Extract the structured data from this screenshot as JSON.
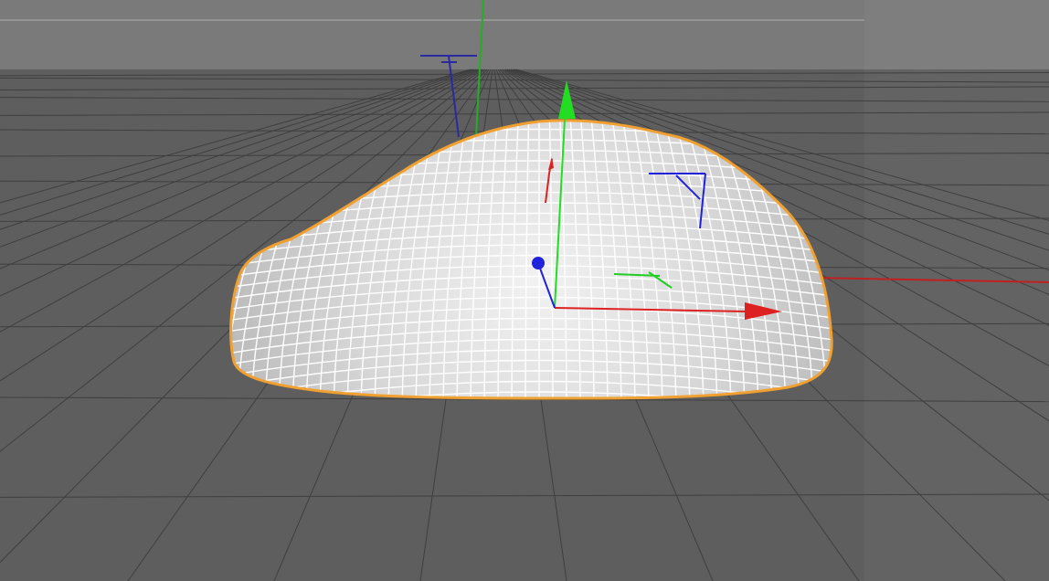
{
  "viewport": {
    "kind": "3d-perspective-viewport",
    "background_color": "#7a7a7a",
    "floor_color": "#5e5e5e",
    "horizon_color": "#959595",
    "grid_color": "#3f3f3f",
    "world_axis_x_color": "#c02020",
    "world_axis_y_color": "#22b022",
    "world_axis_z_color": "#2a2aa0"
  },
  "selected_object": {
    "kind": "subdivided-dome-mesh",
    "selected": true,
    "surface_color": "#e9e9e9",
    "wire_color": "#ffffff",
    "outline_color": "#f0a030"
  },
  "transform_gizmo": {
    "mode": "move",
    "x_axis_color": "#dd2020",
    "y_axis_color": "#22dd22",
    "z_axis_color": "#2222dd"
  }
}
